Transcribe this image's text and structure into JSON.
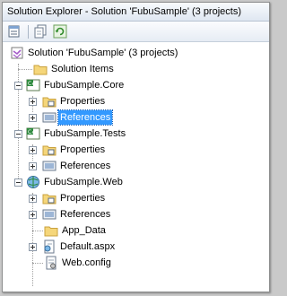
{
  "window": {
    "title": "Solution Explorer - Solution 'FubuSample' (3 projects)"
  },
  "toolbar": {
    "buttons": [
      {
        "icon": "properties-icon"
      },
      {
        "icon": "show-all-files-icon"
      },
      {
        "icon": "refresh-icon"
      }
    ]
  },
  "tree": {
    "solution": "Solution 'FubuSample' (3 projects)",
    "solution_items": "Solution Items",
    "projects": [
      {
        "name": "FubuSample.Core",
        "properties": "Properties",
        "references": "References"
      },
      {
        "name": "FubuSample.Tests",
        "properties": "Properties",
        "references": "References"
      },
      {
        "name": "FubuSample.Web",
        "properties": "Properties",
        "references": "References",
        "app_data": "App_Data",
        "default_aspx": "Default.aspx",
        "web_config": "Web.config"
      }
    ]
  },
  "colors": {
    "selection": "#3399ff",
    "folder": "#f5d67a",
    "project": "#2d8a3e"
  }
}
